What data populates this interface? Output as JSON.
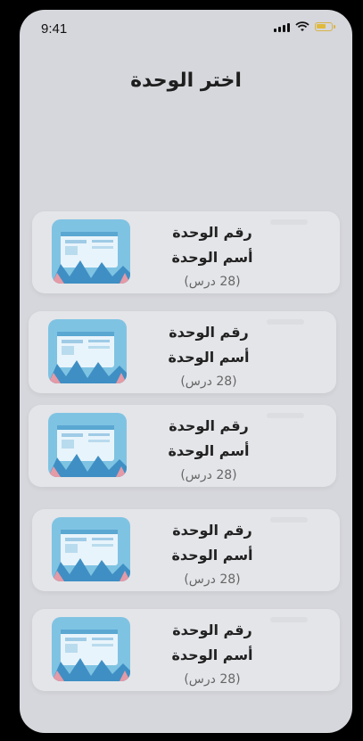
{
  "status_bar": {
    "time": "9:41"
  },
  "header": {
    "title": "اختر الوحدة"
  },
  "units": [
    {
      "number_label": "رقم الوحدة",
      "name_label": "أسم الوحدة",
      "lessons_label": "(28 درس)"
    },
    {
      "number_label": "رقم الوحدة",
      "name_label": "أسم الوحدة",
      "lessons_label": "(28 درس)"
    },
    {
      "number_label": "رقم الوحدة",
      "name_label": "أسم الوحدة",
      "lessons_label": "(28 درس)"
    },
    {
      "number_label": "رقم الوحدة",
      "name_label": "أسم الوحدة",
      "lessons_label": "(28 درس)"
    },
    {
      "number_label": "رقم الوحدة",
      "name_label": "أسم الوحدة",
      "lessons_label": "(28 درس)"
    }
  ],
  "icons": {
    "signal": "cellular-signal-icon",
    "wifi": "wifi-icon",
    "battery": "battery-icon",
    "thumbnail": "unit-thumbnail-illustration"
  },
  "colors": {
    "background": "#d6d7dc",
    "card": "#e4e5e9",
    "thumbnail_sky": "#7fc3e3",
    "battery": "#e1ba3c"
  }
}
